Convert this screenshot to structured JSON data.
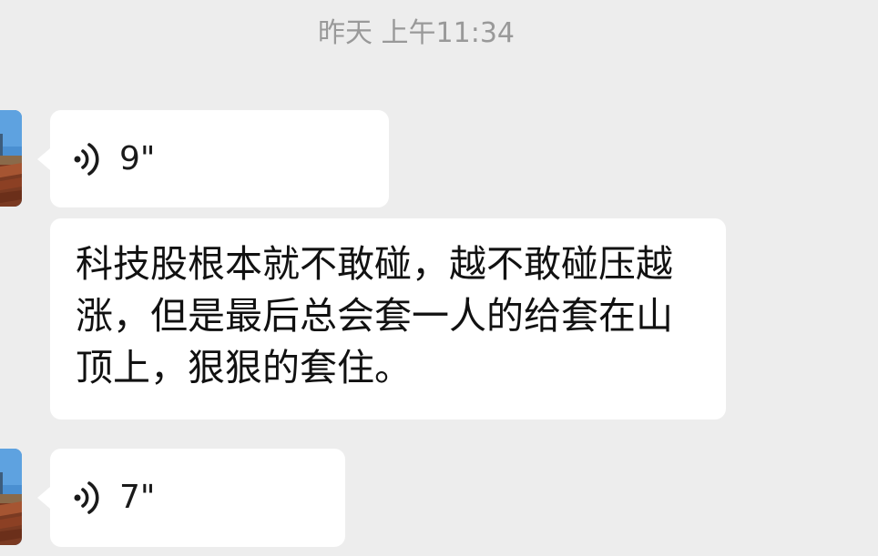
{
  "timestamp": "昨天 上午11:34",
  "messages": [
    {
      "type": "voice",
      "duration": "9\""
    },
    {
      "type": "text",
      "text": "科技股根本就不敢碰，越不敢碰压越涨，但是最后总会套一人的给套在山顶上，狠狠的套住。"
    },
    {
      "type": "voice",
      "duration": "7\""
    }
  ],
  "colors": {
    "background": "#ededed",
    "bubble": "#ffffff",
    "timestamp": "#999999",
    "text": "#111111"
  },
  "icons": {
    "voice": "voice-wave-icon",
    "avatar": "avatar-image"
  }
}
